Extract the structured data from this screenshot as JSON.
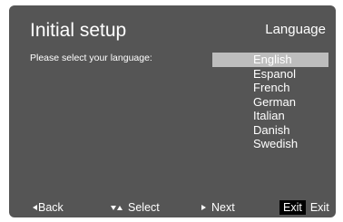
{
  "header": {
    "title": "Initial setup",
    "section": "Language"
  },
  "prompt": "Please select your language:",
  "languages": {
    "selected_index": 0,
    "items": [
      "English",
      "Espanol",
      "French",
      "German",
      "Italian",
      "Danish",
      "Swedish"
    ]
  },
  "footer": {
    "back_label": "Back",
    "select_label": "Select",
    "next_label": "Next",
    "exit_key_label": "Exit",
    "exit_label": "Exit"
  },
  "colors": {
    "screen_background": "#555555",
    "selection_highlight": "#bdbdbd",
    "text": "#ffffff",
    "exit_key_background": "#000000"
  }
}
